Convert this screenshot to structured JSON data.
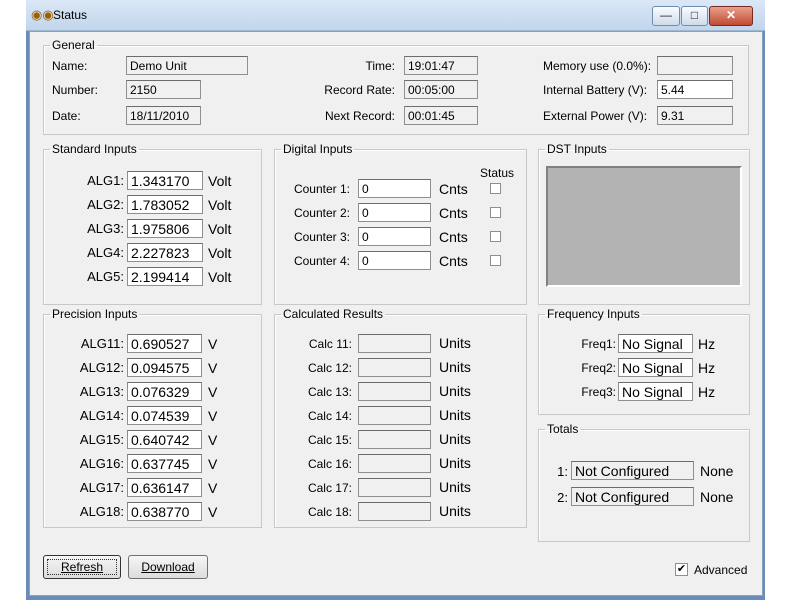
{
  "window": {
    "title": "Status",
    "title_icon": "glasses-icon",
    "controls": {
      "minimize": "—",
      "maximize": "□",
      "close": "✕"
    }
  },
  "general": {
    "legend": "General",
    "name_label": "Name:",
    "name_value": "Demo Unit",
    "number_label": "Number:",
    "number_value": "2150",
    "date_label": "Date:",
    "date_value": "18/11/2010",
    "time_label": "Time:",
    "time_value": "19:01:47",
    "record_rate_label": "Record Rate:",
    "record_rate_value": "00:05:00",
    "next_record_label": "Next Record:",
    "next_record_value": "00:01:45",
    "memory_label": "Memory use (0.0%):",
    "memory_value": "",
    "internal_battery_label": "Internal Battery (V):",
    "internal_battery_value": "5.44",
    "external_power_label": "External Power (V):",
    "external_power_value": "9.31"
  },
  "standard_inputs": {
    "legend": "Standard Inputs",
    "rows": [
      {
        "label": "ALG1:",
        "value": "1.343170",
        "unit": "Volt"
      },
      {
        "label": "ALG2:",
        "value": "1.783052",
        "unit": "Volt"
      },
      {
        "label": "ALG3:",
        "value": "1.975806",
        "unit": "Volt"
      },
      {
        "label": "ALG4:",
        "value": "2.227823",
        "unit": "Volt"
      },
      {
        "label": "ALG5:",
        "value": "2.199414",
        "unit": "Volt"
      }
    ]
  },
  "digital_inputs": {
    "legend": "Digital Inputs",
    "status_header": "Status",
    "rows": [
      {
        "label": "Counter 1:",
        "value": "0",
        "unit": "Cnts",
        "checked": false
      },
      {
        "label": "Counter 2:",
        "value": "0",
        "unit": "Cnts",
        "checked": false
      },
      {
        "label": "Counter 3:",
        "value": "0",
        "unit": "Cnts",
        "checked": false
      },
      {
        "label": "Counter 4:",
        "value": "0",
        "unit": "Cnts",
        "checked": false
      }
    ]
  },
  "dst_inputs": {
    "legend": "DST Inputs"
  },
  "precision_inputs": {
    "legend": "Precision Inputs",
    "rows": [
      {
        "label": "ALG11:",
        "value": "0.690527",
        "unit": "V"
      },
      {
        "label": "ALG12:",
        "value": "0.094575",
        "unit": "V"
      },
      {
        "label": "ALG13:",
        "value": "0.076329",
        "unit": "V"
      },
      {
        "label": "ALG14:",
        "value": "0.074539",
        "unit": "V"
      },
      {
        "label": "ALG15:",
        "value": "0.640742",
        "unit": "V"
      },
      {
        "label": "ALG16:",
        "value": "0.637745",
        "unit": "V"
      },
      {
        "label": "ALG17:",
        "value": "0.636147",
        "unit": "V"
      },
      {
        "label": "ALG18:",
        "value": "0.638770",
        "unit": "V"
      }
    ]
  },
  "calculated_results": {
    "legend": "Calculated Results",
    "rows": [
      {
        "label": "Calc 11:",
        "value": "",
        "unit": "Units"
      },
      {
        "label": "Calc 12:",
        "value": "",
        "unit": "Units"
      },
      {
        "label": "Calc 13:",
        "value": "",
        "unit": "Units"
      },
      {
        "label": "Calc 14:",
        "value": "",
        "unit": "Units"
      },
      {
        "label": "Calc 15:",
        "value": "",
        "unit": "Units"
      },
      {
        "label": "Calc 16:",
        "value": "",
        "unit": "Units"
      },
      {
        "label": "Calc 17:",
        "value": "",
        "unit": "Units"
      },
      {
        "label": "Calc 18:",
        "value": "",
        "unit": "Units"
      }
    ]
  },
  "frequency_inputs": {
    "legend": "Frequency Inputs",
    "rows": [
      {
        "label": "Freq1:",
        "value": "No Signal",
        "unit": "Hz"
      },
      {
        "label": "Freq2:",
        "value": "No Signal",
        "unit": "Hz"
      },
      {
        "label": "Freq3:",
        "value": "No Signal",
        "unit": "Hz"
      }
    ]
  },
  "totals": {
    "legend": "Totals",
    "rows": [
      {
        "label": "1:",
        "value": "Not Configured",
        "unit": "None"
      },
      {
        "label": "2:",
        "value": "Not Configured",
        "unit": "None"
      }
    ]
  },
  "footer": {
    "refresh_label": "Refresh",
    "download_label": "Download",
    "advanced_label": "Advanced",
    "advanced_checked": true,
    "check_mark": "✔"
  }
}
